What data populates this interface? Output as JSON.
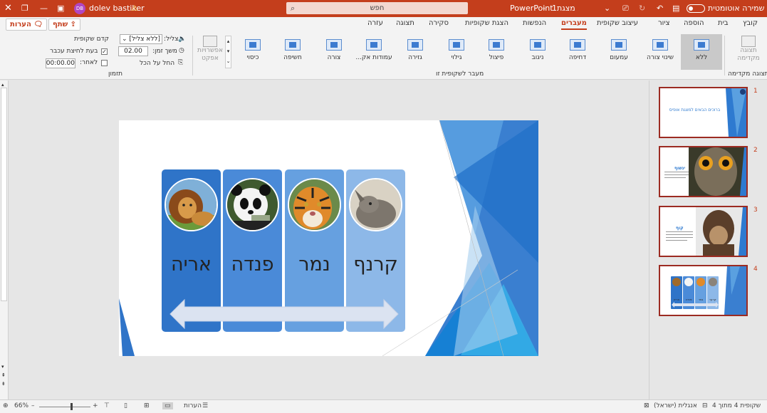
{
  "titlebar": {
    "autosave_label": "שמירה אוטומטית",
    "doc_name": "מצגת1",
    "separator": "-",
    "app_name": "PowerPoint",
    "search_text": "חפש",
    "user_name": "dolev bastiker",
    "user_initials": "DB"
  },
  "tabs": [
    "קובץ",
    "בית",
    "הוספה",
    "ציור",
    "עיצוב שקופית",
    "מעברים",
    "הנפשות",
    "הצגת שקופיות",
    "סקירה",
    "תצוגה",
    "עזרה"
  ],
  "active_tab": "מעברים",
  "topbuttons": {
    "share": "שתף",
    "comments": "הערות"
  },
  "ribbon": {
    "preview_label": "תצוגה מקדימה",
    "preview_group": "תצוגה מקדימה",
    "transitions": [
      "ללא",
      "שינוי צורה",
      "עמעום",
      "דחיפה",
      "ניגוב",
      "פיצול",
      "גילוי",
      "גזירה",
      "עמודות אק...",
      "צורה",
      "חשיפה",
      "כיסוי"
    ],
    "gallery_group": "מעבר לשקופית זו",
    "effect_options": "אפשרויות אפקט",
    "sound_label": "צליל:",
    "sound_value": "[ללא צליל]",
    "duration_label": "משך זמן:",
    "duration_value": "02.00",
    "apply_all": "החל על הכל",
    "advance_label": "קדם שקופית",
    "on_click": "בעת לחיצת עכבר",
    "after_label": "לאחר:",
    "after_value": "00:00.00",
    "timing_group": "תזמון"
  },
  "slide": {
    "cards": [
      {
        "name": "קרנף",
        "animal": "rhino",
        "color": "#8db8e8"
      },
      {
        "name": "נמר",
        "animal": "tiger",
        "color": "#66a0e0"
      },
      {
        "name": "פנדה",
        "animal": "panda",
        "color": "#4a8ad8"
      },
      {
        "name": "אריה",
        "animal": "lion",
        "color": "#2f74c8"
      }
    ]
  },
  "thumbnails": [
    {
      "number": "1",
      "title": "ברוכים הבאים למצגת אופיס"
    },
    {
      "number": "2",
      "title": "ינשוף"
    },
    {
      "number": "3",
      "title": "קוף"
    },
    {
      "number": "4",
      "labels": [
        "קרנף",
        "נמר",
        "פנדה",
        "אריה"
      ]
    }
  ],
  "status": {
    "slide_info": "שקופית 4 מתוך 4",
    "language": "אנגלית (ישראל)",
    "notes": "הערות",
    "zoom": "66%"
  }
}
